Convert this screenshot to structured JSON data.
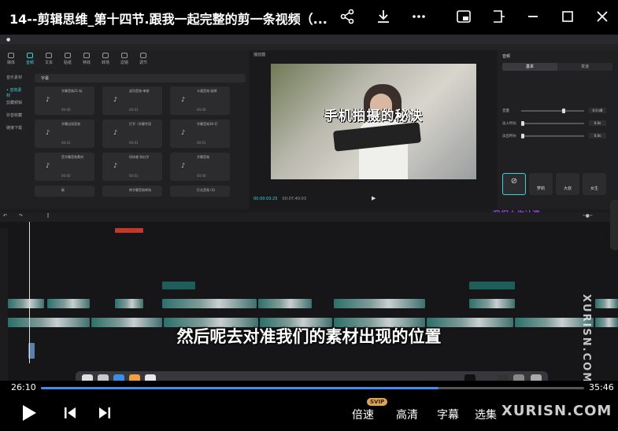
{
  "player": {
    "title": "14--剪辑思维_第十四节.跟我一起完整的剪一条视频（...",
    "current_time": "26:10",
    "total_time": "35:46",
    "progress": 0.7318,
    "controls": {
      "speed": "倍速",
      "speed_badge": "SVIP",
      "quality": "高清",
      "subtitles": "字幕",
      "episodes": "选集"
    }
  },
  "video": {
    "editor": {
      "toolbar": [
        "媒体",
        "音频",
        "文本",
        "贴纸",
        "特效",
        "转场",
        "滤镜",
        "调节"
      ],
      "sidebar": [
        "音乐素材",
        "• 音效素材",
        "剪藏频辑",
        "抖音收藏",
        "链接下载"
      ],
      "search_value": "字幕",
      "cards": [
        {
          "label": "字幕音效21-标",
          "dur": "00:00"
        },
        {
          "label": "战功音效-单按",
          "dur": "00:01"
        },
        {
          "label": "卡通音效-敲掉",
          "dur": "00:00"
        },
        {
          "label": "字幕出场音效",
          "dur": "00:01"
        },
        {
          "label": "打字（字幕专用",
          "dur": "00:01"
        },
        {
          "label": "字幕音效30-打",
          "dur": "00:01"
        },
        {
          "label": "音字幕音效素材",
          "dur": "00:00"
        },
        {
          "label": "科技感 科幻字",
          "dur": "00:01"
        },
        {
          "label": "字幕音效",
          "dur": "00:00"
        },
        {
          "label": "砸",
          "dur": "00:00"
        },
        {
          "label": "转字幕音效转场",
          "dur": "00:01"
        },
        {
          "label": "打击音效 (3)",
          "dur": "00:01"
        }
      ],
      "preview_header": "播放器",
      "preview_caption": "手机拍摄的秘诀",
      "preview_time": "00:00:03:25",
      "preview_total": "00:07:40:03",
      "inspector_title": "音频",
      "inspector_tabs": [
        "基本",
        "变速"
      ],
      "inspector_rows": [
        {
          "label": "音量",
          "value": "0.0 dB"
        },
        {
          "label": "淡入时长",
          "value": "0.0s"
        },
        {
          "label": "淡出时长",
          "value": "0.0s"
        }
      ],
      "voices": [
        "萝莉",
        "大叔",
        "女生"
      ],
      "purple_text": "我们小作计资"
    },
    "subtitle": "然后呢去对准我们的素材出现的位置",
    "watermark_side": "XURISN.COM",
    "watermark_bottom": "XURISN.COM"
  }
}
